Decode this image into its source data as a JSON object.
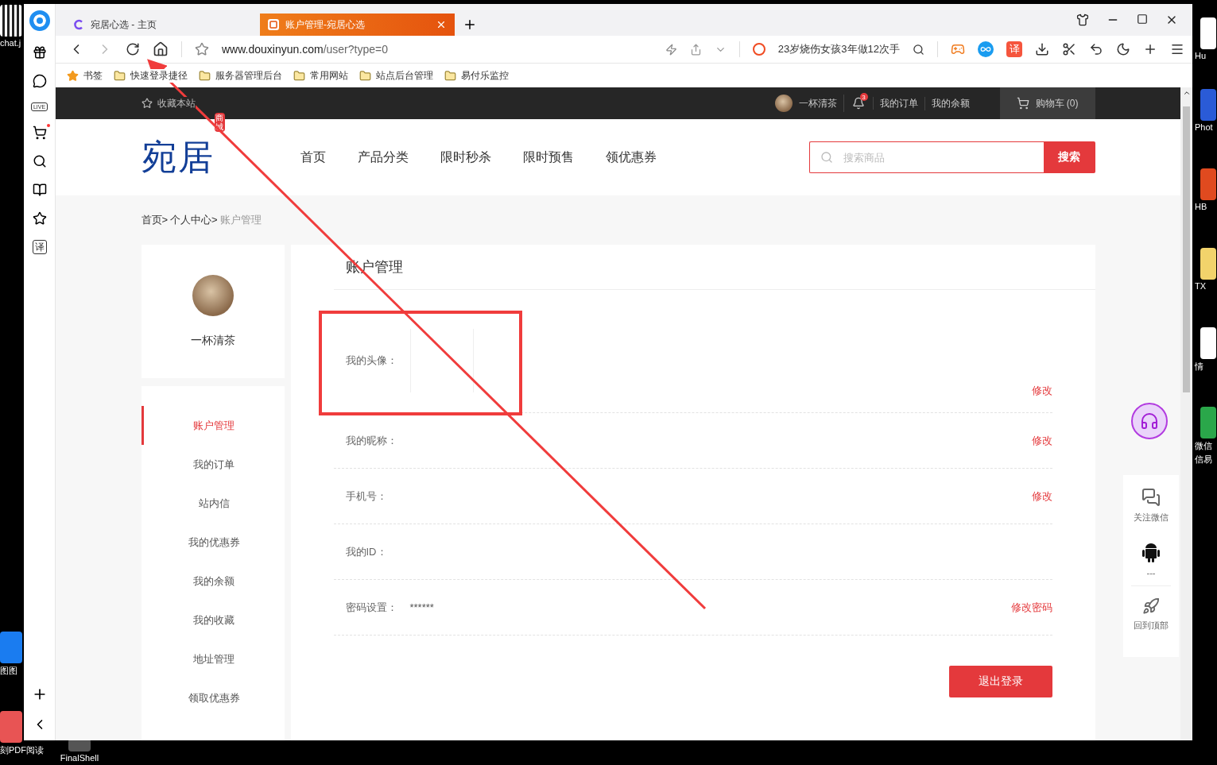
{
  "desktop": {
    "left_icons": [
      {
        "label": "chat.j",
        "color": "#222222",
        "kind": "qr"
      },
      {
        "label": "图图",
        "color": "#1a7cf0",
        "kind": "app"
      },
      {
        "label": "刻PDF阅读",
        "color": "#e85454",
        "kind": "app"
      }
    ],
    "bottom_icons": [
      {
        "label": "FinalShell",
        "color": "#555555",
        "kind": "app"
      }
    ],
    "right_icons": [
      {
        "label": "Hu",
        "color": "#ffffff",
        "kind": "app"
      },
      {
        "label": "Phot",
        "color": "#2a5bd7",
        "kind": "app"
      },
      {
        "label": "HB",
        "color": "#e04a1f",
        "kind": "app"
      },
      {
        "label": "TX",
        "color": "#f2d36b",
        "kind": "app"
      },
      {
        "label": "情",
        "color": "#ffffff",
        "kind": "app"
      },
      {
        "label": "微信",
        "color": "#2aa74a",
        "kind": "app"
      }
    ],
    "right_extra_label": "信易"
  },
  "browser": {
    "tabs": [
      {
        "title": "宛居心选 - 主页",
        "selected": false
      },
      {
        "title": "账户管理-宛居心选",
        "selected": true
      }
    ],
    "url_host": "www.douxinyun.com",
    "url_path": "/user?type=0",
    "search_hint": "23岁烧伤女孩3年做12次手",
    "translate_label": "译",
    "bookmarks": [
      {
        "label": "书签",
        "kind": "star"
      },
      {
        "label": "快速登录捷径",
        "kind": "folder"
      },
      {
        "label": "服务器管理后台",
        "kind": "folder"
      },
      {
        "label": "常用网站",
        "kind": "folder"
      },
      {
        "label": "站点后台管理",
        "kind": "folder"
      },
      {
        "label": "易付乐监控",
        "kind": "folder"
      }
    ],
    "sidebar": {
      "live_label": "LIVE",
      "translate_label": "译",
      "cart_alert": true
    }
  },
  "topbar": {
    "favorite": "收藏本站",
    "username": "一杯清茶",
    "notification_count": "3",
    "links": [
      "我的订单",
      "我的余额"
    ],
    "cart": "购物车 (0)"
  },
  "header": {
    "logo": "宛居",
    "logo_badge": "商城",
    "nav": [
      "首页",
      "产品分类",
      "限时秒杀",
      "限时预售",
      "领优惠券"
    ],
    "search_placeholder": "搜索商品",
    "search_button": "搜索"
  },
  "breadcrumb": [
    {
      "label": "首页>",
      "selected": false
    },
    {
      "label": "个人中心>",
      "selected": false
    },
    {
      "label": "账户管理",
      "selected": true
    }
  ],
  "profile": {
    "name": "一杯清茶"
  },
  "menu": [
    {
      "label": "账户管理",
      "selected": true
    },
    {
      "label": "我的订单",
      "selected": false
    },
    {
      "label": "站内信",
      "selected": false
    },
    {
      "label": "我的优惠券",
      "selected": false
    },
    {
      "label": "我的余额",
      "selected": false
    },
    {
      "label": "我的收藏",
      "selected": false
    },
    {
      "label": "地址管理",
      "selected": false
    },
    {
      "label": "领取优惠券",
      "selected": false
    }
  ],
  "account": {
    "title": "账户管理",
    "rows": [
      {
        "label": "我的头像：",
        "kind": "avatar",
        "action": "修改"
      },
      {
        "label": "我的昵称：",
        "kind": "text",
        "action": "修改"
      },
      {
        "label": "手机号：",
        "kind": "text",
        "action": "修改"
      },
      {
        "label": "我的ID：",
        "kind": "text"
      },
      {
        "label": "密码设置：",
        "kind": "text",
        "value": "******",
        "action": "修改密码"
      }
    ],
    "logout": "退出登录"
  },
  "float_tools": [
    {
      "label": "关注微信",
      "kind": "wechat"
    },
    {
      "label": "---",
      "kind": "android"
    },
    {
      "label": "回到顶部",
      "kind": "rocket"
    }
  ]
}
